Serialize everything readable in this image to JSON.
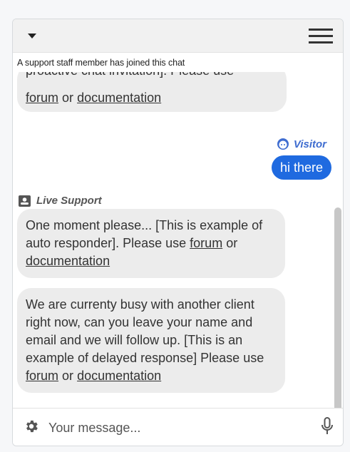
{
  "widget": {
    "system_note": "A support staff member has joined this chat",
    "hidden_partial_line": "proactive chat invitation]. Please use",
    "links": {
      "forum": "forum",
      "or": "or",
      "documentation": "documentation"
    },
    "visitor_label": "Visitor",
    "visitor_message": "hi there",
    "support_label": "Live Support",
    "message1_text": "One moment please... [This is example of auto responder]. Please use",
    "message2_text": "We are currenty busy with another client right now, can you leave your name and email and we will follow up. [This is an example of delayed response] Please use",
    "composer_placeholder": "Your message...",
    "icons": [
      "chevron-down-icon",
      "hamburger-menu-icon",
      "visitor-avatar-icon",
      "support-id-icon",
      "gear-icon",
      "microphone-icon"
    ],
    "colors": {
      "accent": "#1f6ae0",
      "visitor_label": "#3f6dd0",
      "bubble_bg": "#ececec"
    }
  }
}
